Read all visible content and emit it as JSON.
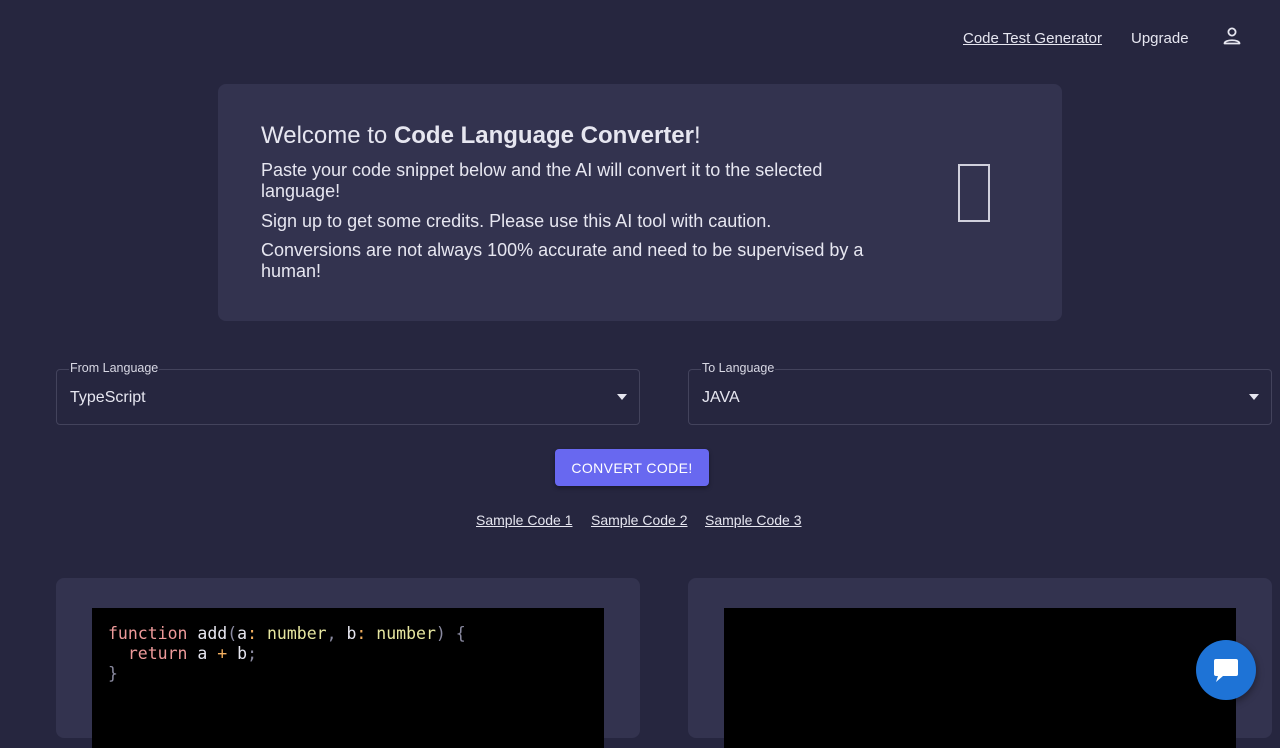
{
  "nav": {
    "code_test_generator": "Code Test Generator",
    "upgrade": "Upgrade",
    "user_icon": "person-icon"
  },
  "welcome": {
    "title_prefix": "Welcome to ",
    "title_bold": "Code Language Converter",
    "title_suffix": "!",
    "glyph": "",
    "line1": "Paste your code snippet below and the AI will convert it to the selected language!",
    "line2a": "Sign up to get some credits.",
    "line2b": "Please use this AI tool with caution.",
    "line3": "Conversions are not always 100% accurate and need to be supervised by a human!"
  },
  "from_language": {
    "label": "From Language",
    "value": "TypeScript"
  },
  "to_language": {
    "label": "To Language",
    "value": "JAVA"
  },
  "convert_button": "CONVERT CODE!",
  "samples": [
    "Sample Code 1",
    "Sample Code 2",
    "Sample Code 3"
  ],
  "source_code": {
    "kw_function": "function",
    "name": " add",
    "paren_open": "(",
    "param_a": "a",
    "colon": ":",
    "type_number": " number",
    "comma": ",",
    "param_b": " b",
    "paren_close": ")",
    "brace_open": " {",
    "indent": "  ",
    "kw_return": "return",
    "expr_a": " a ",
    "plus": "+",
    "expr_b": " b",
    "semicolon": ";",
    "brace_close": "}"
  },
  "chat_icon": "chat-bubble-icon",
  "colors": {
    "background": "#26263f",
    "card": "#33334f",
    "accent_button": "#6868f0",
    "chat_button": "#1e73d6",
    "code_bg": "#000000"
  }
}
